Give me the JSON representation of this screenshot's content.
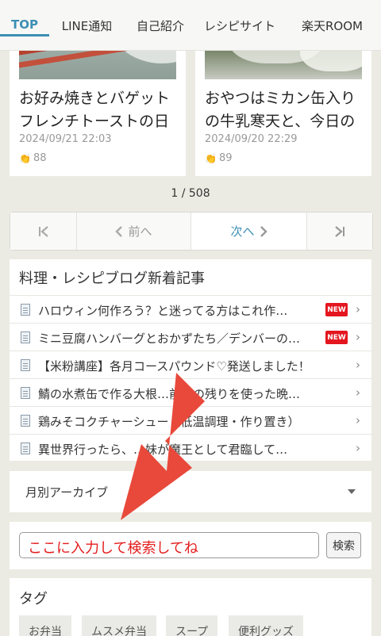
{
  "nav": {
    "tabs": [
      "TOP",
      "LINE通知",
      "自己紹介",
      "レシピサイト",
      "楽天ROOM"
    ]
  },
  "cards": [
    {
      "title": "お好み焼きとバゲットフレンチトーストの日",
      "date": "2024/09/21 22:03",
      "likes": "88"
    },
    {
      "title": "おやつはミカン缶入りの牛乳寒天と、今日の",
      "date": "2024/09/20 22:29",
      "likes": "89"
    }
  ],
  "pager": {
    "count": "1 / 508",
    "prev_label": "前へ",
    "next_label": "次へ"
  },
  "new_articles": {
    "heading": "料理・レシピブログ新着記事",
    "new_badge": "NEW",
    "items": [
      {
        "text": "ハロウィン何作ろう？と迷ってる方はこれ作…",
        "new": true
      },
      {
        "text": "ミニ豆腐ハンバーグとおかずたち／デンバーの…",
        "new": true
      },
      {
        "text": "【米粉講座】各月コースパウンド♡発送しました！",
        "new": false
      },
      {
        "text": "鯖の水煮缶で作る大根…前夜の残りを使った晩…",
        "new": false
      },
      {
        "text": "鶏みそコクチャーシュー（低温調理・作り置き）",
        "new": false
      },
      {
        "text": "異世界行ったら、…妹が魔王として君臨して…",
        "new": false
      }
    ]
  },
  "archive": {
    "label": "月別アーカイブ"
  },
  "search": {
    "placeholder": "ここに入力して検索してね",
    "button": "検索"
  },
  "tags": {
    "heading": "タグ",
    "items": [
      "お弁当",
      "ムスメ弁当",
      "スープ",
      "便利グッズ"
    ]
  },
  "colors": {
    "accent": "#3b8fb4",
    "arrow": "#e8493a",
    "new_badge": "#e4161f",
    "search_text": "#e41e1e"
  }
}
